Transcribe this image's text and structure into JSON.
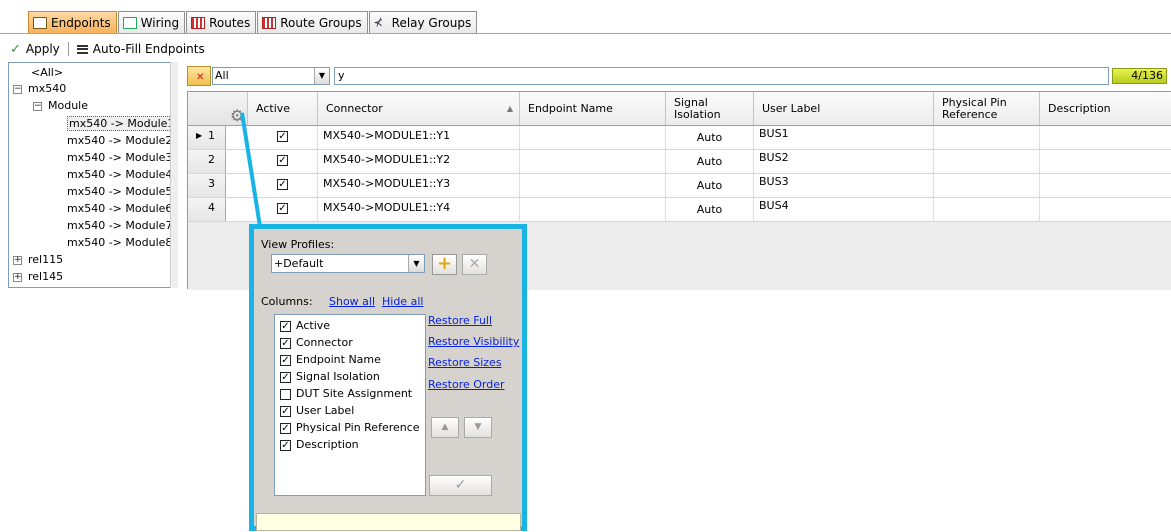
{
  "tabs": [
    {
      "label": "Endpoints",
      "icon": "endpoints-icon",
      "active": true
    },
    {
      "label": "Wiring",
      "icon": "wiring-icon",
      "active": false
    },
    {
      "label": "Routes",
      "icon": "routes-icon",
      "active": false
    },
    {
      "label": "Route Groups",
      "icon": "route-groups-icon",
      "active": false
    },
    {
      "label": "Relay Groups",
      "icon": "relay-groups-icon",
      "active": false
    }
  ],
  "toolbar": {
    "apply_label": "Apply",
    "autofill_label": "Auto-Fill Endpoints"
  },
  "tree": {
    "all": "<All>",
    "mx540": "mx540",
    "module": "Module",
    "modules": [
      "mx540 -> Module1",
      "mx540 -> Module2",
      "mx540 -> Module3",
      "mx540 -> Module4",
      "mx540 -> Module5",
      "mx540 -> Module6",
      "mx540 -> Module7",
      "mx540 -> Module8"
    ],
    "selected_index": 0,
    "rel115": "rel115",
    "rel145": "rel145"
  },
  "filter": {
    "scope": "All",
    "text": "y",
    "count": "4/136"
  },
  "grid": {
    "headers": {
      "active": "Active",
      "connector": "Connector",
      "endpoint_name": "Endpoint Name",
      "signal_isolation": "Signal\nIsolation",
      "user_label": "User Label",
      "physical_pin": "Physical Pin\nReference",
      "description": "Description"
    },
    "rows": [
      {
        "num": "1",
        "active": true,
        "connector": "MX540->MODULE1::Y1",
        "endpoint_name": "",
        "signal_isolation": "Auto",
        "user_label": "BUS1",
        "physical_pin": "",
        "description": ""
      },
      {
        "num": "2",
        "active": true,
        "connector": "MX540->MODULE1::Y2",
        "endpoint_name": "",
        "signal_isolation": "Auto",
        "user_label": "BUS2",
        "physical_pin": "",
        "description": ""
      },
      {
        "num": "3",
        "active": true,
        "connector": "MX540->MODULE1::Y3",
        "endpoint_name": "",
        "signal_isolation": "Auto",
        "user_label": "BUS3",
        "physical_pin": "",
        "description": ""
      },
      {
        "num": "4",
        "active": true,
        "connector": "MX540->MODULE1::Y4",
        "endpoint_name": "",
        "signal_isolation": "Auto",
        "user_label": "BUS4",
        "physical_pin": "",
        "description": ""
      }
    ]
  },
  "popup": {
    "view_profiles_label": "View Profiles:",
    "profile_value": "+Default",
    "columns_label": "Columns:",
    "show_all": "Show all",
    "hide_all": "Hide all",
    "columns": [
      {
        "label": "Active",
        "checked": true
      },
      {
        "label": "Connector",
        "checked": true
      },
      {
        "label": "Endpoint Name",
        "checked": true
      },
      {
        "label": "Signal Isolation",
        "checked": true
      },
      {
        "label": "DUT Site Assignment",
        "checked": false
      },
      {
        "label": "User Label",
        "checked": true
      },
      {
        "label": "Physical Pin Reference",
        "checked": true
      },
      {
        "label": "Description",
        "checked": true
      }
    ],
    "links": {
      "restore_full": "Restore Full",
      "restore_visibility": "Restore Visibility",
      "restore_sizes": "Restore Sizes",
      "restore_order": "Restore Order"
    }
  },
  "colors": {
    "accent_callout": "#19b4e6",
    "active_tab": "#f8b25b",
    "counter": "#c7d92a",
    "link": "#0a23d6"
  }
}
